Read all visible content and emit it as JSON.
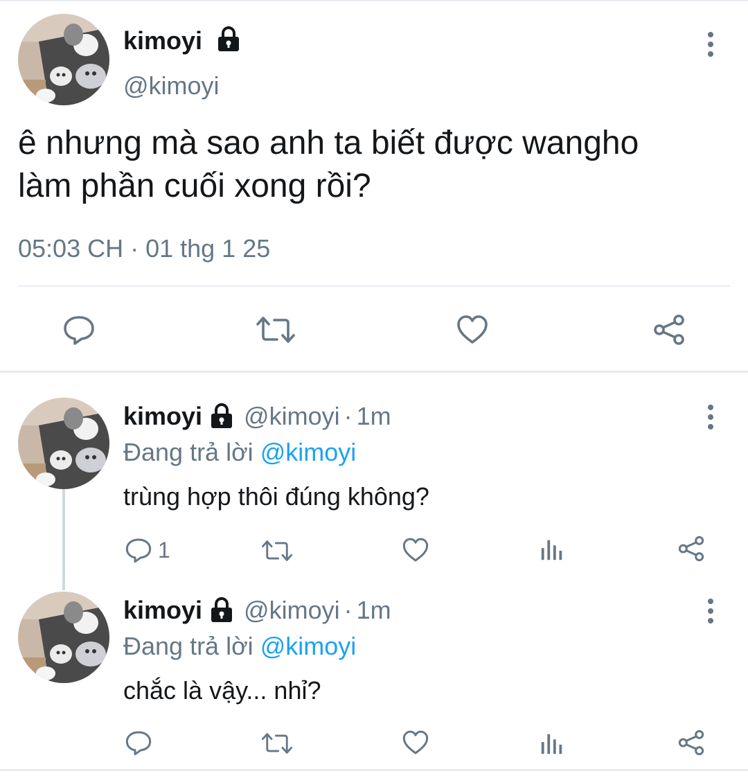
{
  "main_tweet": {
    "display_name": "kimoyi",
    "handle": "@kimoyi",
    "text_line1": "ê nhưng mà sao anh ta biết được wangho",
    "text_line2": "làm phần cuối xong rồi?",
    "timestamp": "05:03 CH · 01 thg 1 25"
  },
  "replies": [
    {
      "display_name": "kimoyi",
      "handle": "@kimoyi",
      "time": "1m",
      "replying_prefix": "Đang trả lời",
      "replying_to": "@kimoyi",
      "text": "trùng hợp thôi đúng không?",
      "reply_count": "1"
    },
    {
      "display_name": "kimoyi",
      "handle": "@kimoyi",
      "time": "1m",
      "replying_prefix": "Đang trả lời",
      "replying_to": "@kimoyi",
      "text": "chắc là vậy... nhỉ?",
      "reply_count": ""
    }
  ],
  "separator": "·",
  "icons": {
    "lock": "lock-icon",
    "more": "more-vertical-icon",
    "reply": "reply-icon",
    "retweet": "retweet-icon",
    "like": "heart-icon",
    "stats": "stats-icon",
    "share": "share-icon"
  },
  "colors": {
    "text": "#14171a",
    "secondary": "#657786",
    "link": "#1da1f2",
    "divider": "#e6ecf0"
  }
}
